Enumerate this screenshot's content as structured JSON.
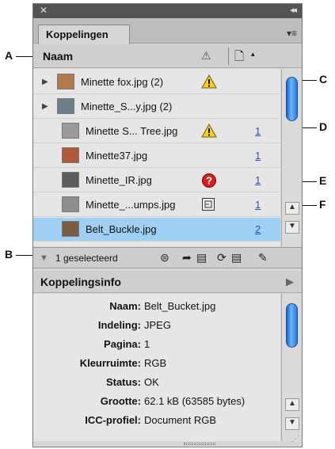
{
  "callouts": {
    "a": "A",
    "b": "B",
    "c": "C",
    "d": "D",
    "e": "E",
    "f": "F"
  },
  "panel": {
    "close_glyph": "✕",
    "collapse_glyph": "◂◂",
    "tab_label": "Koppelingen",
    "menu_glyph": "▾≡"
  },
  "column_header": {
    "name_label": "Naam",
    "warn_glyph": "⚠",
    "page_glyph": "🗋",
    "sort_glyph": "▴"
  },
  "links": [
    {
      "name": "Minette fox.jpg (2)",
      "expandable": true,
      "status_icon": "warning-icon",
      "page": "",
      "thumb_color": "#b07a4a"
    },
    {
      "name": "Minette_S...y.jpg (2)",
      "expandable": true,
      "status_icon": "",
      "page": "",
      "thumb_color": "#6d7f89"
    },
    {
      "name": "Minette S... Tree.jpg",
      "expandable": false,
      "status_icon": "warning-icon",
      "page": "1",
      "thumb_color": "#9a9a9a"
    },
    {
      "name": "Minette37.jpg",
      "expandable": false,
      "status_icon": "",
      "page": "1",
      "thumb_color": "#b05a3a"
    },
    {
      "name": "Minette_IR.jpg",
      "expandable": false,
      "status_icon": "missing-icon",
      "page": "1",
      "thumb_color": "#5c5c5c"
    },
    {
      "name": "Minette_...umps.jpg",
      "expandable": false,
      "status_icon": "embedded-icon",
      "page": "1",
      "thumb_color": "#8e8e8e"
    },
    {
      "name": "Belt_Buckle.jpg",
      "expandable": false,
      "status_icon": "",
      "page": "2",
      "thumb_color": "#7a5c46",
      "selected": true
    }
  ],
  "status_bar": {
    "selected_text": "1 geselecteerd",
    "triangle_glyph": "▼"
  },
  "info_panel": {
    "title": "Koppelingsinfo",
    "rows": [
      {
        "key": "Naam:",
        "value": "Belt_Bucket.jpg"
      },
      {
        "key": "Indeling:",
        "value": "JPEG"
      },
      {
        "key": "Pagina:",
        "value": "1"
      },
      {
        "key": "Kleurruimte:",
        "value": "RGB"
      },
      {
        "key": "Status:",
        "value": "OK"
      },
      {
        "key": "Grootte:",
        "value": "62.1 kB (63585 bytes)"
      },
      {
        "key": "ICC-profiel:",
        "value": "Document RGB"
      }
    ]
  },
  "colors": {
    "selection": "#9fd0f3",
    "link_page": "#2a50c8",
    "scroll_thumb": "#2a77d9"
  }
}
